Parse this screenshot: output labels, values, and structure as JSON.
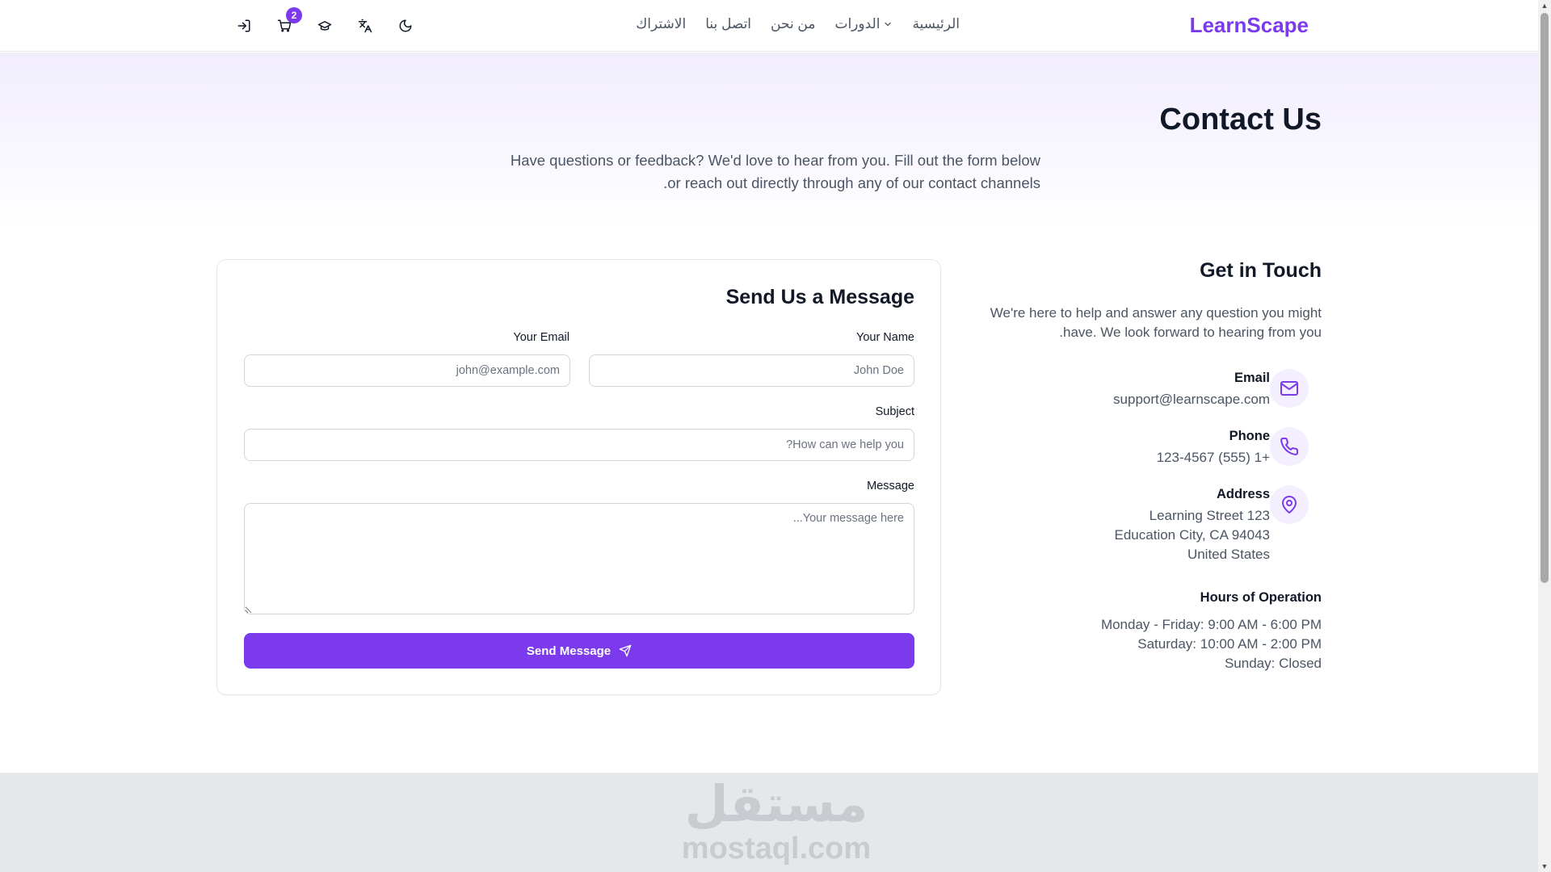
{
  "header": {
    "logo": "LearnScape",
    "nav": {
      "home": "الرئيسية",
      "courses": "الدورات",
      "about": "من نحن",
      "contact": "اتصل بنا",
      "subscribe": "الاشتراك"
    },
    "cart_count": "2",
    "icons": [
      "moon-icon",
      "translate-icon",
      "graduation-cap-icon",
      "cart-icon",
      "login-icon"
    ]
  },
  "hero": {
    "title": "Contact Us",
    "subtitle": "Have questions or feedback? We'd love to hear from you. Fill out the form below or reach out directly through any of our contact channels."
  },
  "form": {
    "title": "Send Us a Message",
    "name_label": "Your Name",
    "name_placeholder": "John Doe",
    "email_label": "Your Email",
    "email_placeholder": "john@example.com",
    "subject_label": "Subject",
    "subject_placeholder": "How can we help you?",
    "message_label": "Message",
    "message_placeholder": "Your message here...",
    "submit_label": "Send Message"
  },
  "contact": {
    "title": "Get in Touch",
    "lead": "We're here to help and answer any question you might have. We look forward to hearing from you.",
    "email_title": "Email",
    "email_value": "support@learnscape.com",
    "phone_title": "Phone",
    "phone_value": "+1 (555) 123-4567",
    "address_title": "Address",
    "address_line1": "123 Learning Street",
    "address_line2": "Education City, CA 94043",
    "address_line3": "United States",
    "hours_title": "Hours of Operation",
    "hours_weekday": "Monday - Friday: 9:00 AM - 6:00 PM",
    "hours_saturday": "Saturday: 10:00 AM - 2:00 PM",
    "hours_sunday": "Sunday: Closed"
  },
  "footer": {
    "watermark_ar": "مستقل",
    "watermark_en": "mostaql.com"
  },
  "colors": {
    "accent": "#7c3aed",
    "accent_light": "#f3effe",
    "text": "#111827",
    "muted": "#4b5563"
  }
}
